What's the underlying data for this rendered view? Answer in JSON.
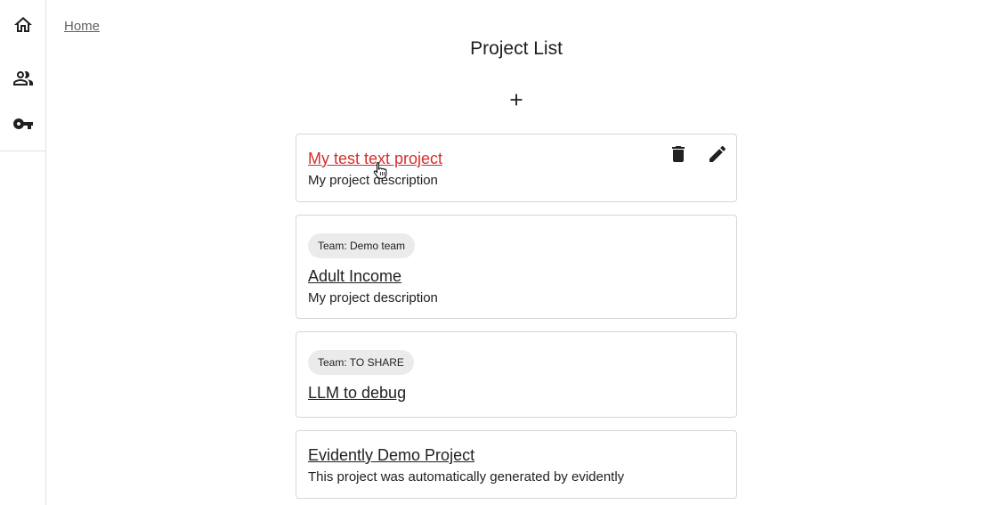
{
  "sidebar": {
    "items": [
      {
        "name": "home",
        "icon": "home-icon"
      },
      {
        "name": "teams",
        "icon": "people-icon"
      },
      {
        "name": "tokens",
        "icon": "key-icon"
      }
    ]
  },
  "breadcrumb": {
    "home_label": "Home"
  },
  "header": {
    "title": "Project List"
  },
  "toolbar": {
    "add_icon": "plus-icon"
  },
  "projects": [
    {
      "title": "My test text project",
      "description": "My project description",
      "team": ""
    },
    {
      "title": "Adult Income",
      "description": "My project description",
      "team": "Team: Demo team"
    },
    {
      "title": "LLM to debug",
      "description": "",
      "team": "Team: TO SHARE"
    },
    {
      "title": "Evidently Demo Project",
      "description": "This project was automatically generated by evidently",
      "team": ""
    }
  ],
  "colors": {
    "hover_link": "#d32f2f",
    "chip_bg": "#ebebeb",
    "border": "#d6d6d6"
  }
}
